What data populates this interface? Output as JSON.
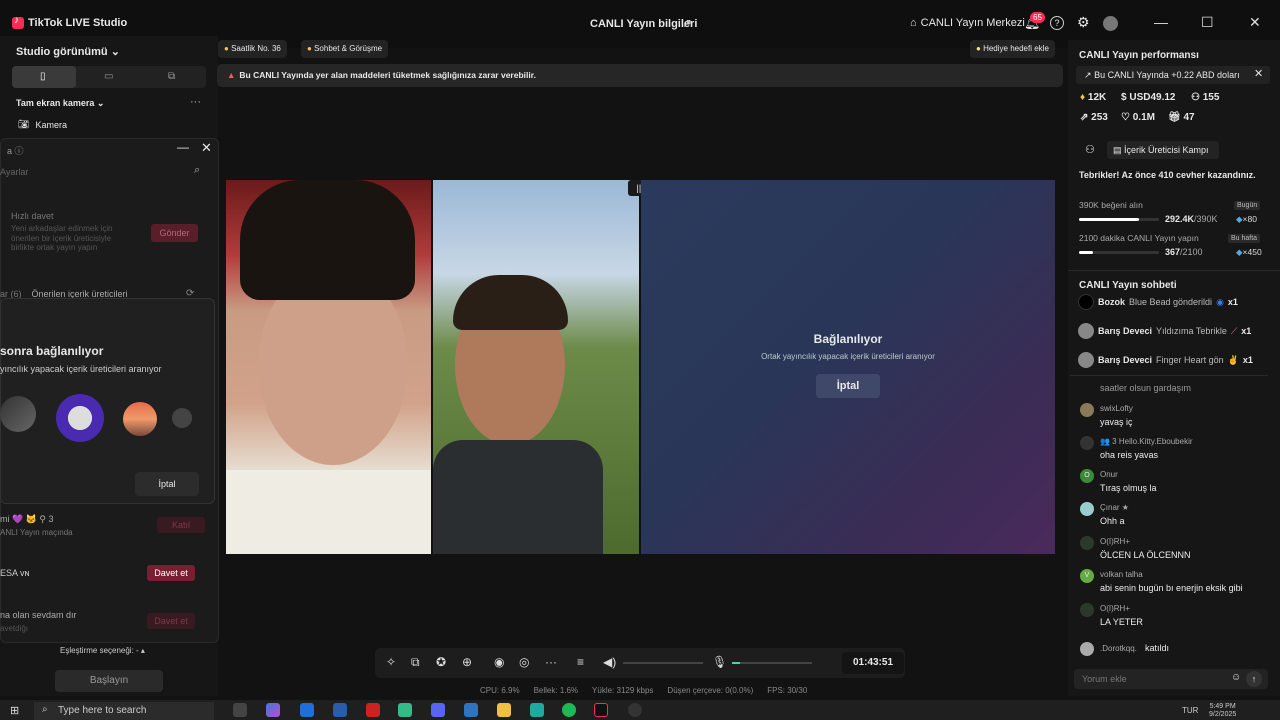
{
  "titlebar": {
    "app_title": "TikTok LIVE Studio",
    "center_title": "CANLI Yayın bilgileri",
    "live_center": "CANLI Yayın Merkezi",
    "notif_count": "65"
  },
  "left": {
    "studio_view": "Studio görünümü",
    "full_camera": "Tam ekran kamera",
    "camera": "Kamera",
    "cohost": {
      "search_placeholder": "Ayarlar",
      "quick_invite_title": "Hızlı davet",
      "quick_invite_desc": "Yeni arkadaşlar edinmek için önerilen bir içerik üreticisiyle birlikte ortak yayın yapın",
      "send_label": "Gönder",
      "tab_left": "ar (6)",
      "tab_suggested": "Önerilen içerik üreticileri",
      "connecting_title": "sonra bağlanılıyor",
      "connecting_sub": "yıncılık yapacak içerik üreticileri aranıyor",
      "cancel_label": "İptal",
      "rows": [
        {
          "name": "mi 💜 🐱  ⚲ 3",
          "sub": "ANLI Yayın maçında",
          "btn": "Katıl"
        },
        {
          "name": "ESA ᴠɴ",
          "sub": "",
          "btn": "Davet et"
        },
        {
          "name": "na olan sevdam dır",
          "sub": "avetdiğı",
          "btn": "Davet et"
        }
      ],
      "match_option": "Eşleştirme seçeneği: -",
      "start_label": "Başlayın"
    }
  },
  "chips": {
    "hourly": "Saatlik No. 36",
    "chat_meet": "Sohbet & Görüşme",
    "gift_goal": "Hediye hedefi ekle"
  },
  "warning": "Bu CANLI Yayında yer alan maddeleri tüketmek sağlığınıza zarar verebilir.",
  "video": {
    "connecting_title": "Bağlanılıyor",
    "connecting_sub": "Ortak yayıncılık yapacak içerik üreticileri aranıyor",
    "cancel": "İptal"
  },
  "toolbar": {
    "timer": "01:43:51",
    "mic_level": 0.1
  },
  "stats": {
    "cpu": "CPU: 6.9%",
    "memory": "Bellek: 1.6%",
    "upload": "Yükle: 3129 kbps",
    "dropped": "Düşen çerçeve: 0(0.0%)",
    "fps": "FPS: 30/30"
  },
  "right": {
    "perf_title": "CANLI Yayın performansı",
    "perf_banner": "Bu CANLI Yayında +0.22 ABD doları",
    "stats": {
      "diamonds": "12K",
      "usd": "USD49.12",
      "followers": "155",
      "shares": "253",
      "likes": "0.1M",
      "gifts": "47"
    },
    "camp": "İçerik Üreticisi Kampı",
    "congrats": "Tebrikler! Az önce 410 cevher kazandınız.",
    "goals": [
      {
        "label": "390K beğeni alın",
        "tag": "Bugün",
        "value_bold": "292.4K",
        "value_total": "/390K",
        "reward": "×80",
        "progress": 0.75
      },
      {
        "label": "2100 dakika CANLI Yayın yapın",
        "tag": "Bu hafta",
        "value_bold": "367",
        "value_total": "/2100",
        "reward": "×450",
        "progress": 0.17
      }
    ],
    "chat_title": "CANLI Yayın sohbeti",
    "gifts": [
      {
        "user": "Bozok",
        "text": "Blue Bead gönderildi",
        "count": "x1"
      },
      {
        "user": "Barış Deveci",
        "text": "Yıldızıma Tebrikle",
        "count": "x1"
      },
      {
        "user": "Barış Deveci",
        "text": "Finger Heart gön",
        "count": "x1"
      }
    ],
    "partial_msg": "saatler olsun gardaşım",
    "chat": [
      {
        "user": "swixLofty",
        "msg": "yavaş iç"
      },
      {
        "user": "👥 3  Hello.Kitty.Eboubekir",
        "msg": "oha reis yavas"
      },
      {
        "user": "Onur",
        "msg": "Tıraş olmuş la"
      },
      {
        "user": "Çınar ★",
        "msg": "Ohh a"
      },
      {
        "user": "O(I)RH+",
        "msg": "ÖLCEN LA ÖLCENNN"
      },
      {
        "user": "volkan talha",
        "msg": "abi senin bugün bı enerjin eksik gibi"
      },
      {
        "user": "O(I)RH+",
        "msg": "LA YETER"
      }
    ],
    "joined_user": ".Dorotkqq.",
    "joined_text": "katıldı",
    "comment_placeholder": "Yorum ekle"
  },
  "taskbar": {
    "search": "Type here to search",
    "lang": "TUR",
    "time": "5:49 PM",
    "date": "9/2/2025"
  }
}
